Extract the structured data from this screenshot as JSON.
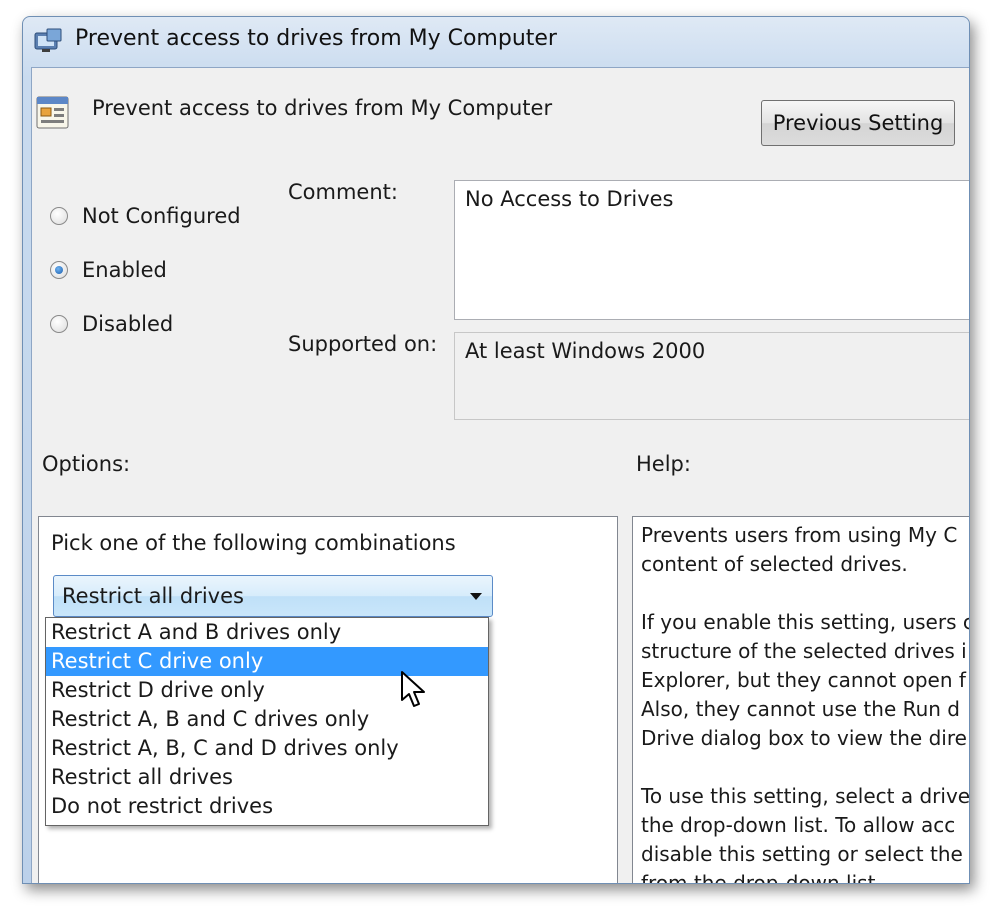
{
  "window": {
    "title": "Prevent access to drives from My Computer"
  },
  "policy": {
    "title": "Prevent access to drives from My Computer"
  },
  "buttons": {
    "previous_setting": "Previous Setting"
  },
  "radios": {
    "not_configured": "Not Configured",
    "enabled": "Enabled",
    "disabled": "Disabled",
    "selected": "Enabled"
  },
  "labels": {
    "comment": "Comment:",
    "supported_on": "Supported on:",
    "options": "Options:",
    "help": "Help:"
  },
  "comment": {
    "value": "No Access to Drives"
  },
  "supported_on": {
    "value": "At least Windows 2000"
  },
  "options": {
    "prompt": "Pick one of the following combinations",
    "combo_value": "Restrict all drives",
    "dropdown_items": [
      "Restrict A and B drives only",
      "Restrict C drive only",
      "Restrict D drive only",
      "Restrict A, B and C drives only",
      "Restrict A, B, C and D drives only",
      "Restrict all drives",
      "Do not restrict drives"
    ],
    "highlighted_item": "Restrict C drive only"
  },
  "help": {
    "lines": [
      "Prevents users from using My C",
      "content of selected drives.",
      "If you enable this setting, users c",
      "structure of the selected drives i",
      "Explorer, but they cannot open f",
      "Also, they cannot use the Run d",
      "Drive dialog box to view the dire",
      "To use this setting, select a drive",
      "the drop-down list. To allow acc",
      "disable this setting or select the",
      "from the drop-down list."
    ]
  },
  "colors": {
    "selection": "#3399ff",
    "window_frame": "#c9dbef",
    "dialog_bg": "#f0f0f0"
  },
  "icons": {
    "title": "policy-window-icon",
    "policy": "policy-setting-icon",
    "combo": "chevron-down-icon",
    "cursor": "mouse-pointer-icon"
  }
}
